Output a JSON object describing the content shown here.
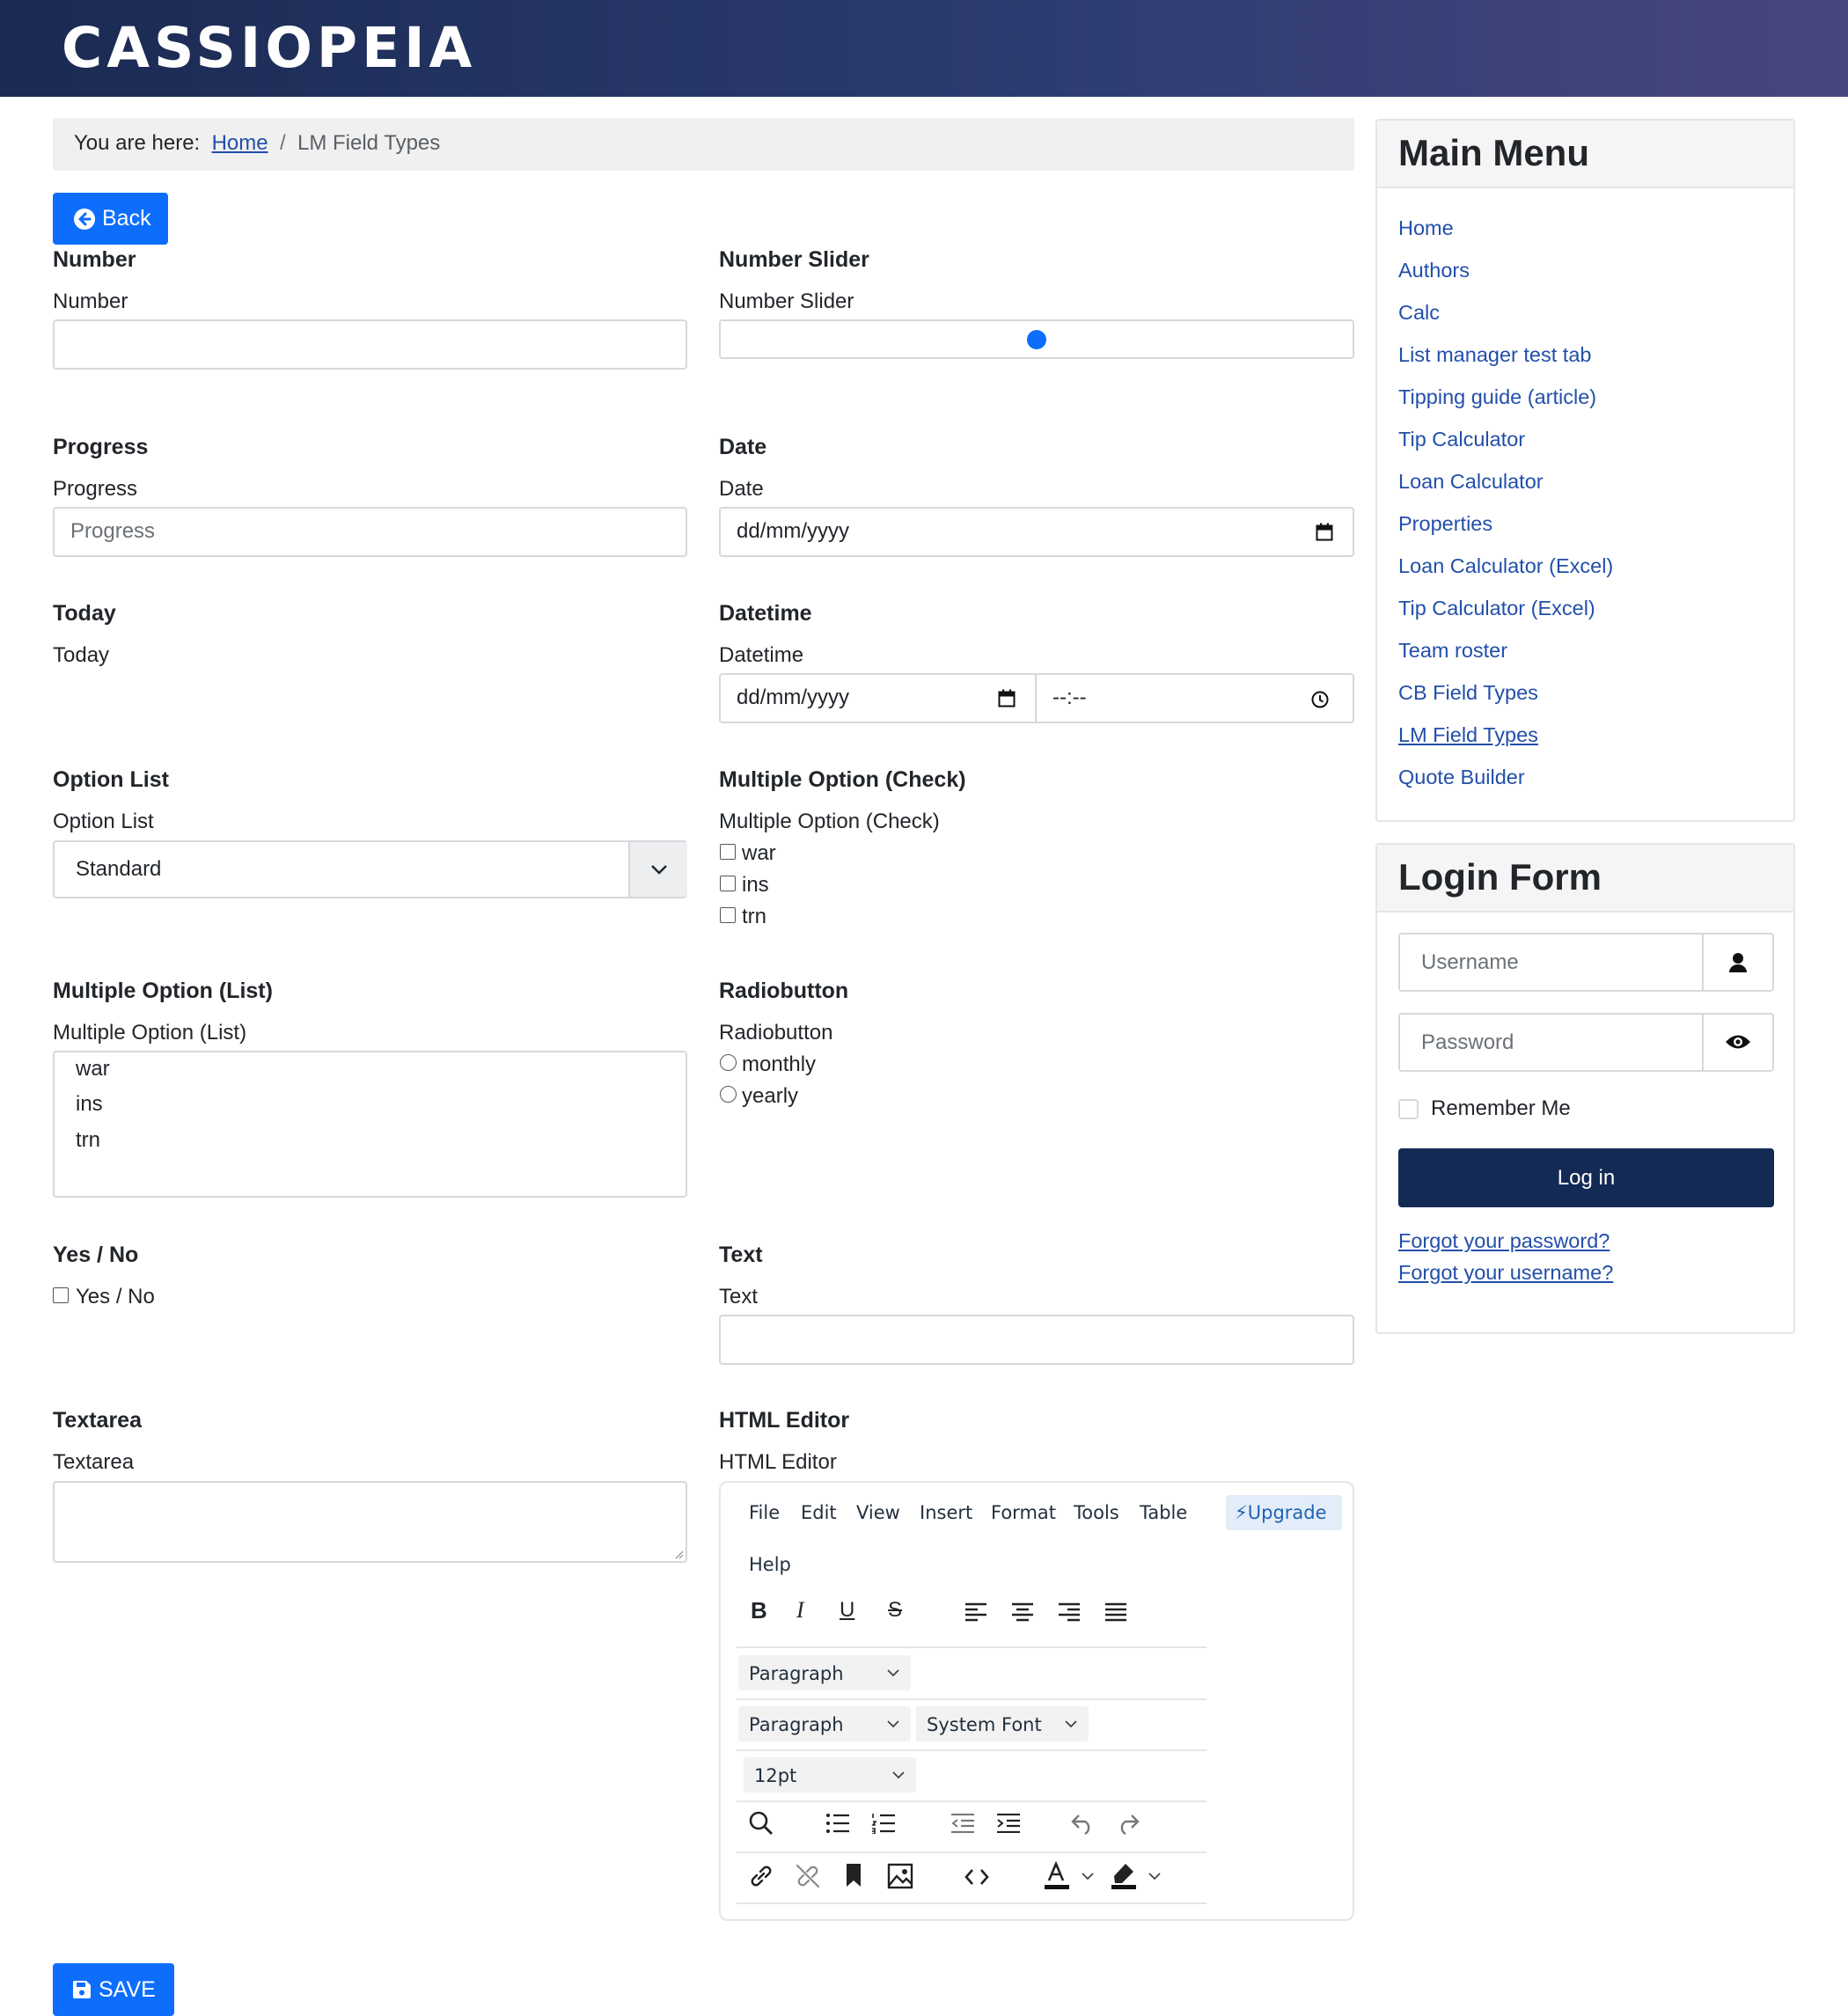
{
  "site": {
    "logo": "CASSIOPEIA"
  },
  "breadcrumb": {
    "prefix": "You are here:",
    "home": "Home",
    "separator": "/",
    "current": "LM Field Types"
  },
  "back_button": {
    "label": "Back"
  },
  "fields": {
    "number": {
      "heading": "Number",
      "label": "Number",
      "value": ""
    },
    "number_slider": {
      "heading": "Number Slider",
      "label": "Number Slider",
      "value_fraction": 0.5
    },
    "progress": {
      "heading": "Progress",
      "label": "Progress",
      "placeholder": "Progress"
    },
    "date": {
      "heading": "Date",
      "label": "Date",
      "placeholder": "dd/mm/yyyy"
    },
    "today": {
      "heading": "Today",
      "label": "Today"
    },
    "datetime": {
      "heading": "Datetime",
      "label": "Datetime",
      "date_placeholder": "dd/mm/yyyy",
      "time_placeholder": "--:--"
    },
    "option_list": {
      "heading": "Option List",
      "label": "Option List",
      "selected": "Standard"
    },
    "multi_check": {
      "heading": "Multiple Option (Check)",
      "label": "Multiple Option (Check)",
      "options": [
        "war",
        "ins",
        "trn"
      ]
    },
    "multi_list": {
      "heading": "Multiple Option (List)",
      "label": "Multiple Option (List)",
      "options": [
        "war",
        "ins",
        "trn"
      ]
    },
    "radio": {
      "heading": "Radiobutton",
      "label": "Radiobutton",
      "options": [
        "monthly",
        "yearly"
      ]
    },
    "yes_no": {
      "heading": "Yes / No",
      "label": "Yes / No"
    },
    "text": {
      "heading": "Text",
      "label": "Text",
      "value": ""
    },
    "textarea": {
      "heading": "Textarea",
      "label": "Textarea",
      "value": ""
    },
    "html_editor": {
      "heading": "HTML Editor",
      "label": "HTML Editor",
      "menus": [
        "File",
        "Edit",
        "View",
        "Insert",
        "Format",
        "Tools",
        "Table",
        "Help"
      ],
      "upgrade": "⚡Upgrade",
      "block_select_1": "Paragraph",
      "block_select_2": "Paragraph",
      "font_select": "System Font",
      "size_select": "12pt"
    }
  },
  "save_button": {
    "label": "SAVE"
  },
  "main_menu": {
    "title": "Main Menu",
    "items": [
      "Home",
      "Authors",
      "Calc",
      "List manager test tab",
      "Tipping guide (article)",
      "Tip Calculator",
      "Loan Calculator",
      "Properties",
      "Loan Calculator (Excel)",
      "Tip Calculator (Excel)",
      "Team roster",
      "CB Field Types",
      "LM Field Types",
      "Quote Builder"
    ],
    "active_item": "LM Field Types"
  },
  "login_form": {
    "title": "Login Form",
    "username_placeholder": "Username",
    "password_placeholder": "Password",
    "remember_label": "Remember Me",
    "login_button": "Log in",
    "forgot_password": "Forgot your password?",
    "forgot_username": "Forgot your username?"
  },
  "colors": {
    "header_start": "#1a2a52",
    "header_end": "#48467e",
    "primary": "#0d6efd",
    "link": "#224faa",
    "login_button": "#132a55"
  }
}
